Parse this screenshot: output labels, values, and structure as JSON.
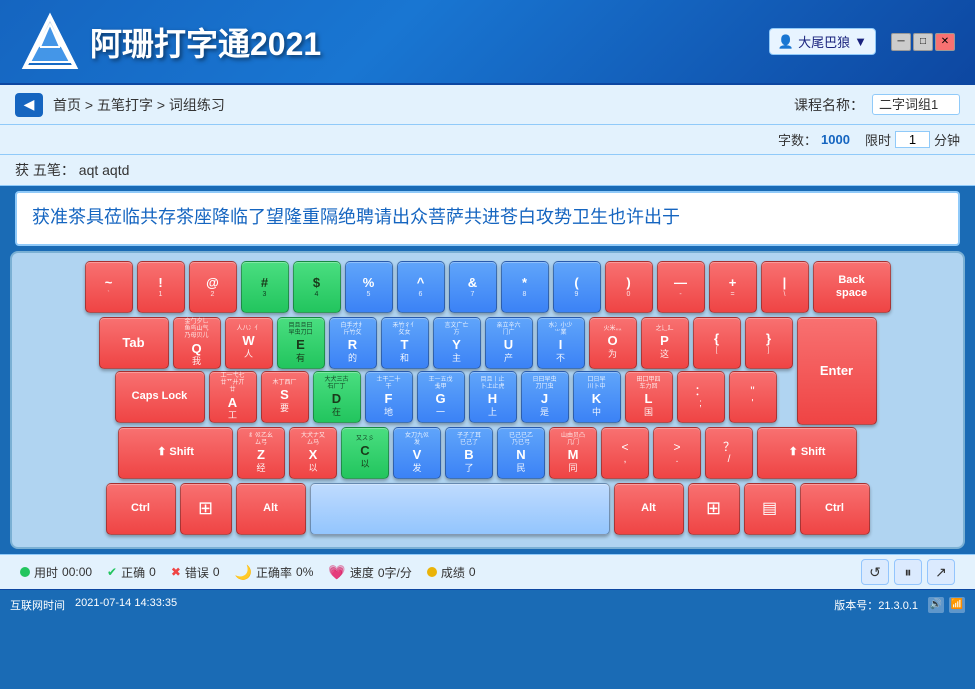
{
  "header": {
    "logo_text": "阿珊打字通2021",
    "user_name": "大尾巴狼",
    "min_btn": "─",
    "max_btn": "□",
    "close_btn": "✕"
  },
  "navbar": {
    "back_icon": "◀",
    "breadcrumb": "首页 > 五笔打字 > 词组练习",
    "course_label": "课程名称：",
    "course_value": "二字词组1"
  },
  "stats": {
    "word_count_label": "字数：",
    "word_count": "1000",
    "time_limit_label": "限时",
    "time_limit": "1",
    "minute_label": "分钟"
  },
  "hint": {
    "label": "获 五笔：",
    "code": "aqt aqtd"
  },
  "typing_text": "获准茶具莅临共存茶座降临了望隆重隔绝聘请出众菩萨共进苍白攻势卫生也许出于",
  "keyboard": {
    "row1": [
      {
        "label": "~\n`",
        "type": "red"
      },
      {
        "label": "!\n1",
        "type": "red"
      },
      {
        "label": "@\n2",
        "type": "red"
      },
      {
        "label": "#\n3",
        "type": "green"
      },
      {
        "label": "$\n4",
        "type": "green"
      },
      {
        "label": "%\n5",
        "type": "blue"
      },
      {
        "label": "^\n6",
        "type": "blue"
      },
      {
        "label": "&\n7",
        "type": "blue"
      },
      {
        "label": "*\n8",
        "type": "blue"
      },
      {
        "label": "(\n9",
        "type": "blue"
      },
      {
        "label": ")\n0",
        "type": "red"
      },
      {
        "label": "_\n-",
        "type": "red"
      },
      {
        "label": "+\n=",
        "type": "red"
      },
      {
        "label": "|\n\\",
        "type": "red"
      },
      {
        "label": "Back\nspace",
        "type": "red",
        "wide": true
      }
    ],
    "caps_lock_label": "Caps Lock",
    "tab_label": "Tab",
    "enter_label": "Enter",
    "shift_left_label": "⬆ Shift",
    "shift_right_label": "⬆ Shift",
    "ctrl_left_label": "Ctrl",
    "ctrl_right_label": "Ctrl",
    "alt_left_label": "Alt",
    "alt_right_label": "Alt",
    "space_label": ""
  },
  "status_bar": {
    "time_label": "用时",
    "time_value": "00:00",
    "correct_label": "正确",
    "correct_value": "0",
    "error_label": "错误",
    "error_value": "0",
    "accuracy_label": "正确率",
    "accuracy_value": "0%",
    "speed_label": "速度",
    "speed_value": "0字/分",
    "score_label": "成绩",
    "score_value": "0"
  },
  "taskbar": {
    "time_label": "互联网时间",
    "datetime": "2021-07-14  14:33:35",
    "version": "版本号：21.3.0.1"
  }
}
